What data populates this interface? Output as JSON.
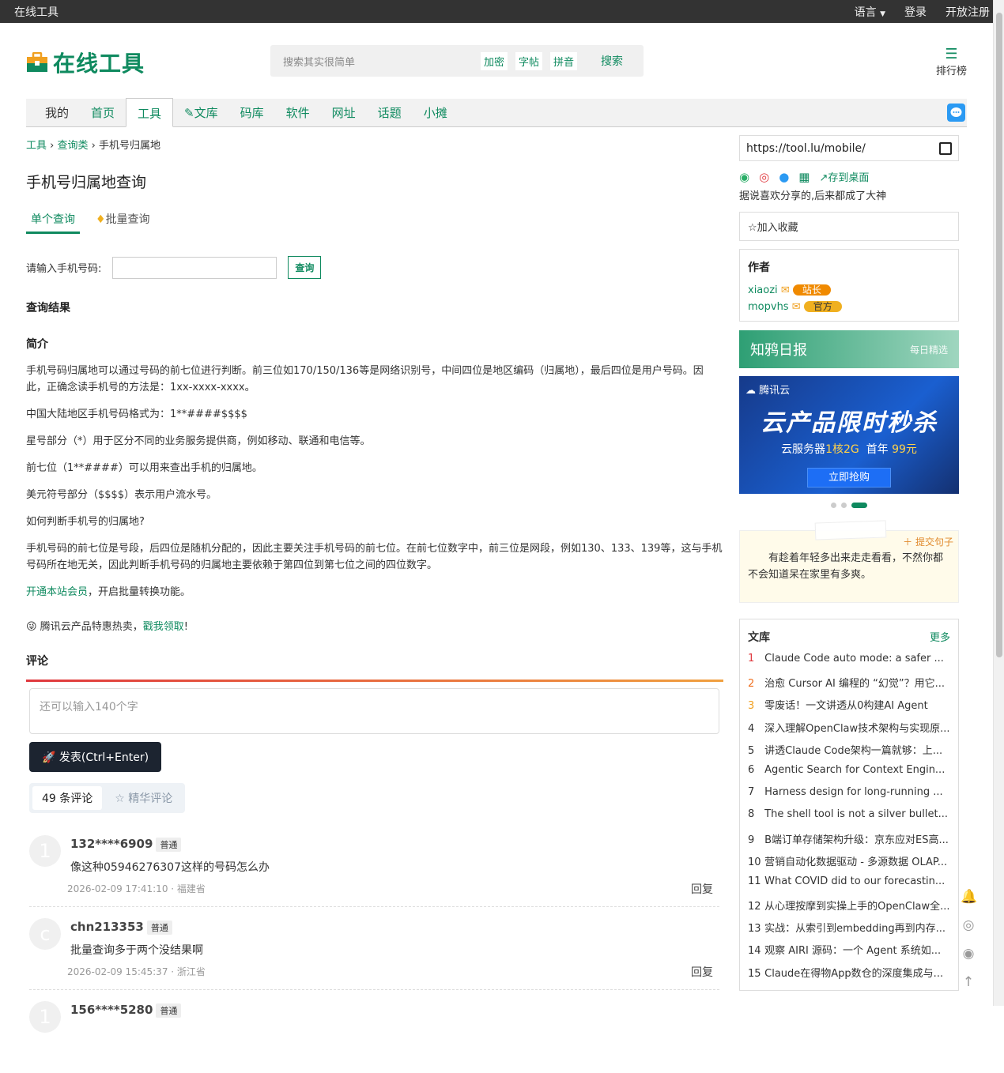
{
  "topbar": {
    "site_name": "在线工具",
    "language": "语言",
    "login": "登录",
    "register": "开放注册"
  },
  "header": {
    "logo_text": "在线工具",
    "search_placeholder": "搜索其实很简单",
    "search_tags": [
      "加密",
      "字帖",
      "拼音"
    ],
    "search_button": "搜索",
    "rank_label": "排行榜"
  },
  "nav": {
    "items": [
      "我的",
      "首页",
      "工具",
      "文库",
      "码库",
      "软件",
      "网址",
      "话题",
      "小摊"
    ],
    "active": "工具"
  },
  "breadcrumb": {
    "l1": "工具",
    "l2": "查询类",
    "l3": "手机号归属地"
  },
  "page": {
    "title": "手机号归属地查询",
    "tab_single": "单个查询",
    "tab_batch": "批量查询",
    "input_label": "请输入手机号码:",
    "query_button": "查询",
    "result_heading": "查询结果",
    "intro_heading": "简介"
  },
  "intro": {
    "p1": "手机号码归属地可以通过号码的前七位进行判断。前三位如170/150/136等是网络识别号，中间四位是地区编码（归属地），最后四位是用户号码。因此，正确念读手机号的方法是：1xx-xxxx-xxxx。",
    "p2": "中国大陆地区手机号码格式为：1**####$$$$",
    "p3": "星号部分（*）用于区分不同的业务服务提供商，例如移动、联通和电信等。",
    "p4": "前七位（1**####）可以用来查出手机的归属地。",
    "p5": "美元符号部分（$$$$）表示用户流水号。",
    "p6": "如何判断手机号的归属地?",
    "p7": "手机号码的前七位是号段，后四位是随机分配的，因此主要关注手机号码的前七位。在前七位数字中，前三位是网段，例如130、133、139等，这与手机号码所在地无关，因此判断手机号码的归属地主要依赖于第四位到第七位之间的四位数字。",
    "vip_link": "开通本站会员",
    "vip_text": "，开启批量转换功能。",
    "promo_text": "腾讯云产品特惠热卖，",
    "promo_link": "戳我领取",
    "promo_end": "!"
  },
  "comments": {
    "heading": "评论",
    "placeholder": "还可以输入140个字",
    "post_button": "发表(Ctrl+Enter)",
    "tab_all": "49 条评论",
    "tab_best": "精华评论",
    "reply_label": "回复",
    "items": [
      {
        "avatar": "1",
        "name": "132****6909",
        "level": "普通",
        "text": "像这种05946276307这样的号码怎么办",
        "meta": "2026-02-09 17:41:10 · 福建省"
      },
      {
        "avatar": "c",
        "name": "chn213353",
        "level": "普通",
        "text": "批量查询多于两个没结果啊",
        "meta": "2026-02-09 15:45:37 · 浙江省"
      },
      {
        "avatar": "1",
        "name": "156****5280",
        "level": "普通",
        "text": "",
        "meta": ""
      }
    ]
  },
  "sidebar": {
    "url": "https://tool.lu/mobile/",
    "save_desktop": "存到桌面",
    "slogan": "据说喜欢分享的,后来都成了大神",
    "favorite": "加入收藏",
    "author_heading": "作者",
    "authors": [
      {
        "name": "xiaozi",
        "badge": "站长"
      },
      {
        "name": "mopvhs",
        "badge": "官方"
      }
    ],
    "zhiya_title": "知鸦日报",
    "zhiya_sub": "每日精选",
    "ad_brand": "腾讯云",
    "ad_title": "云产品限时秒杀",
    "ad_line_a": "云服务器",
    "ad_line_b": "1核2G",
    "ad_line_c": "首年",
    "ad_line_d": "99元",
    "ad_button": "立即抢购",
    "note_submit": "提交句子",
    "note_text": "有趁着年轻多出来走走看看，不然你都不会知道呆在家里有多爽。",
    "lib_heading": "文库",
    "lib_more": "更多",
    "lib_items": [
      "Claude Code auto mode: a safer ...",
      "治愈 Cursor AI 编程的 “幻觉”？用它...",
      "零废话！一文讲透从0构建AI Agent",
      "深入理解OpenClaw技术架构与实现原...",
      "讲透Claude Code架构一篇就够：上...",
      "Agentic Search for Context Engin...",
      "Harness design for long-running ...",
      "The shell tool is not a silver bullet...",
      "B端订单存储架构升级：京东应对ES高...",
      "营销自动化数据驱动 - 多源数据 OLAP...",
      "What COVID did to our forecastin...",
      "从心理按摩到实操上手的OpenClaw全...",
      "实战：从索引到embedding再到内存...",
      "观察 AIRI 源码：一个 Agent 系统如...",
      "Claude在得物App数仓的深度集成与..."
    ]
  },
  "colors": {
    "accent": "#0f8a5f",
    "topbar": "#333333",
    "badge": "#f0a020",
    "rank_top": "#e0383e"
  }
}
